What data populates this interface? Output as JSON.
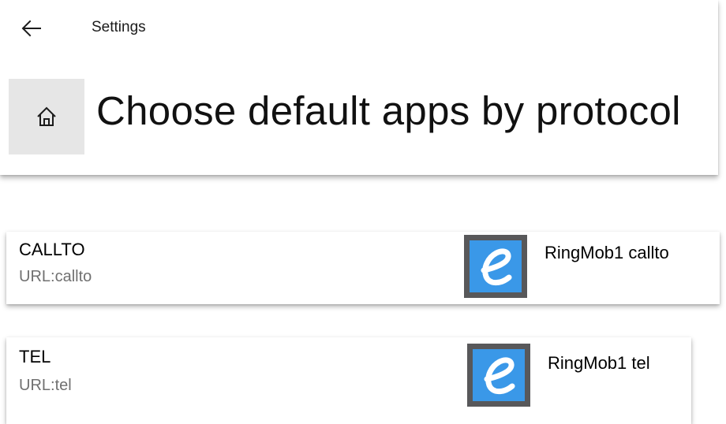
{
  "window": {
    "title": "Settings"
  },
  "icons": {
    "back": "back-arrow-icon",
    "home": "home-icon",
    "app": "ringmob-e-icon"
  },
  "page": {
    "title": "Choose default apps by protocol"
  },
  "protocols": [
    {
      "name": "CALLTO",
      "description": "URL:callto",
      "default_app": "RingMob1 callto"
    },
    {
      "name": "TEL",
      "description": "URL:tel",
      "default_app": "RingMob1 tel"
    }
  ],
  "colors": {
    "home_button_bg": "#e6e6e6",
    "app_icon_frame": "#58585a",
    "app_icon_fill": "#3a98e8",
    "secondary_text": "#707070"
  }
}
